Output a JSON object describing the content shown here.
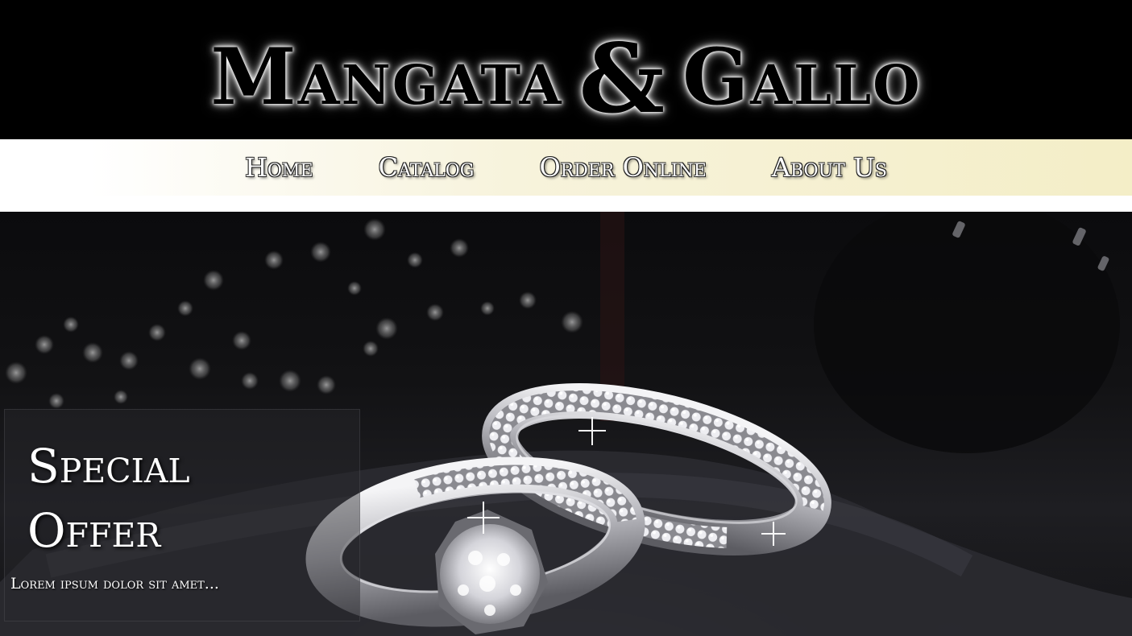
{
  "header": {
    "logo_part1": "Mangata",
    "logo_amp": "&",
    "logo_part2": "Gallo"
  },
  "nav": {
    "items": [
      {
        "label": "Home"
      },
      {
        "label": "Catalog"
      },
      {
        "label": "Order Online"
      },
      {
        "label": "About Us"
      }
    ]
  },
  "hero": {
    "image_icon": "rings-icon",
    "offer": {
      "title_line1": "Special",
      "title_line2": "Offer",
      "text": "Lorem ipsum dolor sit amet..."
    }
  },
  "colors": {
    "header_bg": "#000000",
    "nav_gradient_start": "#ffffff",
    "nav_gradient_end": "#f4eec7"
  }
}
